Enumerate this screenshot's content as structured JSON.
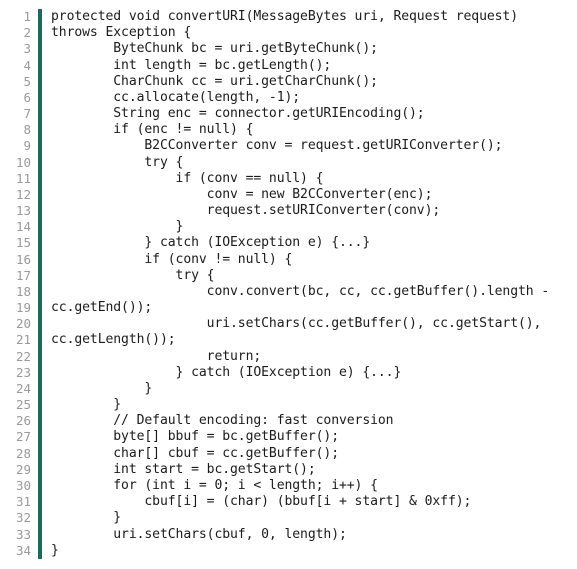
{
  "document": {
    "kind": "source-code-listing",
    "language": "Java",
    "method": "convertURI",
    "colors": {
      "background": "#ffffff",
      "code_text": "#1b1b1b",
      "line_number": "#9a9a9a",
      "gutter_rule": "#1f6b5a"
    },
    "gutter": {
      "first_line": 1,
      "last_line": 34,
      "line_numbers": [
        "1",
        "2",
        "3",
        "4",
        "5",
        "6",
        "7",
        "8",
        "9",
        "10",
        "11",
        "12",
        "13",
        "14",
        "15",
        "16",
        "17",
        "18",
        "19",
        "20",
        "21",
        "22",
        "23",
        "24",
        "25",
        "26",
        "27",
        "28",
        "29",
        "30",
        "31",
        "32",
        "33",
        "34"
      ]
    },
    "lines": [
      {
        "n": "1",
        "text": "protected void convertURI(MessageBytes uri, Request request)",
        "wrapped": false
      },
      {
        "n": "2",
        "text": "throws Exception {",
        "wrapped": false
      },
      {
        "n": "3",
        "text": "        ByteChunk bc = uri.getByteChunk();",
        "wrapped": false
      },
      {
        "n": "4",
        "text": "        int length = bc.getLength();",
        "wrapped": false
      },
      {
        "n": "5",
        "text": "        CharChunk cc = uri.getCharChunk();",
        "wrapped": false
      },
      {
        "n": "6",
        "text": "        cc.allocate(length, -1);",
        "wrapped": false
      },
      {
        "n": "7",
        "text": "        String enc = connector.getURIEncoding();",
        "wrapped": false
      },
      {
        "n": "8",
        "text": "        if (enc != null) {",
        "wrapped": false
      },
      {
        "n": "9",
        "text": "            B2CConverter conv = request.getURIConverter();",
        "wrapped": false
      },
      {
        "n": "10",
        "text": "            try {",
        "wrapped": false
      },
      {
        "n": "11",
        "text": "                if (conv == null) {",
        "wrapped": false
      },
      {
        "n": "12",
        "text": "                    conv = new B2CConverter(enc);",
        "wrapped": false
      },
      {
        "n": "13",
        "text": "                    request.setURIConverter(conv);",
        "wrapped": false
      },
      {
        "n": "14",
        "text": "                }",
        "wrapped": false
      },
      {
        "n": "15",
        "text": "            } catch (IOException e) {...}",
        "wrapped": false
      },
      {
        "n": "16",
        "text": "            if (conv != null) {",
        "wrapped": false
      },
      {
        "n": "17",
        "text": "                try {",
        "wrapped": false
      },
      {
        "n": "18",
        "text": "                    conv.convert(bc, cc, cc.getBuffer().length -",
        "wrapped": false
      },
      {
        "n": "19",
        "text": "cc.getEnd());",
        "wrapped": true
      },
      {
        "n": "20",
        "text": "                    uri.setChars(cc.getBuffer(), cc.getStart(),",
        "wrapped": false
      },
      {
        "n": "21",
        "text": "cc.getLength());",
        "wrapped": true
      },
      {
        "n": "22",
        "text": "                    return;",
        "wrapped": false
      },
      {
        "n": "23",
        "text": "                } catch (IOException e) {...}",
        "wrapped": false
      },
      {
        "n": "24",
        "text": "            }",
        "wrapped": false
      },
      {
        "n": "25",
        "text": "        }",
        "wrapped": false
      },
      {
        "n": "26",
        "text": "        // Default encoding: fast conversion",
        "wrapped": false
      },
      {
        "n": "27",
        "text": "        byte[] bbuf = bc.getBuffer();",
        "wrapped": false
      },
      {
        "n": "28",
        "text": "        char[] cbuf = cc.getBuffer();",
        "wrapped": false
      },
      {
        "n": "29",
        "text": "        int start = bc.getStart();",
        "wrapped": false
      },
      {
        "n": "30",
        "text": "        for (int i = 0; i < length; i++) {",
        "wrapped": false
      },
      {
        "n": "31",
        "text": "            cbuf[i] = (char) (bbuf[i + start] & 0xff);",
        "wrapped": false
      },
      {
        "n": "32",
        "text": "        }",
        "wrapped": false
      },
      {
        "n": "33",
        "text": "        uri.setChars(cbuf, 0, length);",
        "wrapped": false
      },
      {
        "n": "34",
        "text": "}",
        "wrapped": false
      }
    ]
  }
}
